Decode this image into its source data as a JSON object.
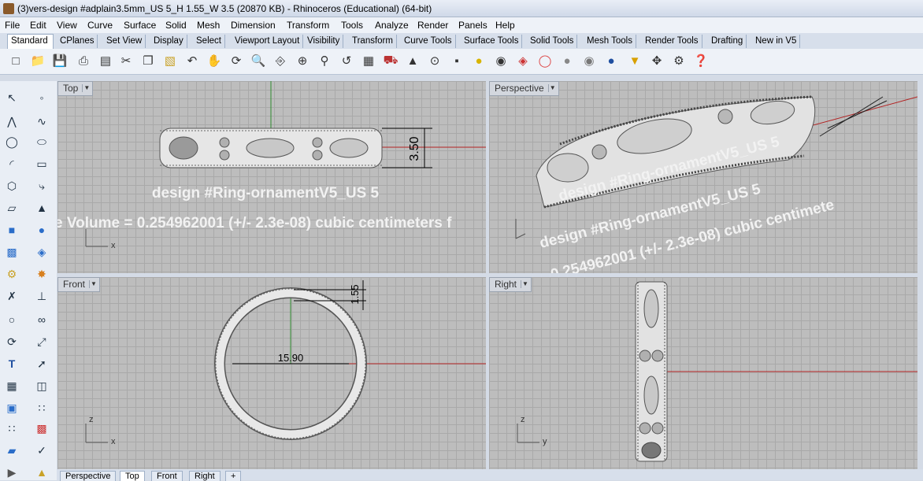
{
  "window": {
    "title": "(3)vers-design #adplain3.5mm_US 5_H 1.55_W 3.5 (20870 KB) - Rhinoceros (Educational) (64-bit)"
  },
  "menu": [
    "File",
    "Edit",
    "View",
    "Curve",
    "Surface",
    "Solid",
    "Mesh",
    "Dimension",
    "Transform",
    "Tools",
    "Analyze",
    "Render",
    "Panels",
    "Help"
  ],
  "tabs": [
    "Standard",
    "CPlanes",
    "Set View",
    "Display",
    "Select",
    "Viewport Layout",
    "Visibility",
    "Transform",
    "Curve Tools",
    "Surface Tools",
    "Solid Tools",
    "Mesh Tools",
    "Render Tools",
    "Drafting",
    "New in V5"
  ],
  "active_tab": "Standard",
  "viewports": {
    "top": {
      "label": "Top",
      "dimension": "3.50",
      "annotation1": "design #Ring-ornamentV5_US 5",
      "annotation2": "e Volume = 0.254962001 (+/- 2.3e-08) cubic centimeters f",
      "axis_x": "x"
    },
    "perspective": {
      "label": "Perspective",
      "annotation1": "design #Ring-ornamentV5_US 5",
      "annotation2": "design #Ring-ornamentV5_US 5",
      "annotation3": "0.254962001 (+/- 2.3e-08) cubic centimete"
    },
    "front": {
      "label": "Front",
      "dimension_diameter": "15.90",
      "dimension_thickness": "1.55",
      "axis_z": "z",
      "axis_x": "x"
    },
    "right": {
      "label": "Right",
      "axis_z": "z",
      "axis_y": "y"
    }
  },
  "bottom_tabs": [
    "Perspective",
    "Top",
    "Front",
    "Right",
    "+"
  ],
  "active_bottom_tab": "Top",
  "colors": {
    "grid_bg": "#bdbdbd",
    "grid_line": "#a9a9a9",
    "axis_red": "#b22222",
    "axis_green": "#2e8b2e"
  }
}
